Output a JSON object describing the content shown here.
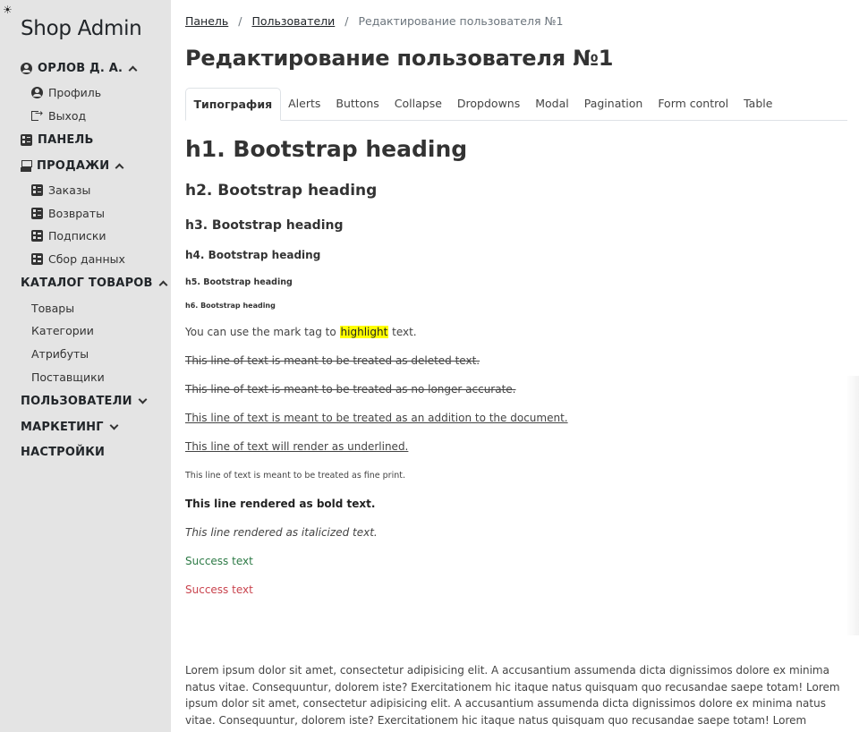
{
  "sidebar": {
    "brand": "Shop Admin",
    "user": {
      "label": "ОРЛОВ Д. А.",
      "items": [
        "Профиль",
        "Выход"
      ]
    },
    "panel": "ПАНЕЛЬ",
    "sales": {
      "label": "ПРОДАЖИ",
      "items": [
        "Заказы",
        "Возвраты",
        "Подписки",
        "Сбор данных"
      ]
    },
    "catalog": {
      "label": "КАТАЛОГ ТОВАРОВ",
      "items": [
        "Товары",
        "Категории",
        "Атрибуты",
        "Поставщики"
      ]
    },
    "users": "ПОЛЬЗОВАТЕЛИ",
    "marketing": "МАРКЕТИНГ",
    "settings": "НАСТРОЙКИ"
  },
  "breadcrumb": [
    "Панель",
    "Пользователи",
    "Редактирование пользователя №1"
  ],
  "breadcrumb_sep": "/",
  "page_title": "Редактирование пользователя №1",
  "tabs": [
    "Типография",
    "Alerts",
    "Buttons",
    "Collapse",
    "Dropdowns",
    "Modal",
    "Pagination",
    "Form control",
    "Table"
  ],
  "typography": {
    "h1": "h1. Bootstrap heading",
    "h2": "h2. Bootstrap heading",
    "h3": "h3. Bootstrap heading",
    "h4": "h4. Bootstrap heading",
    "h5": "h5. Bootstrap heading",
    "h6": "h6. Bootstrap heading",
    "mark_before": "You can use the mark tag to ",
    "mark_word": "highlight",
    "mark_after": " text.",
    "deleted": "This line of text is meant to be treated as deleted text.",
    "strike": "This line of text is meant to be treated as no longer accurate.",
    "inserted": "This line of text is meant to be treated as an addition to the document.",
    "underlined": "This line of text will render as underlined.",
    "fine_print": "This line of text is meant to be treated as fine print.",
    "bold": "This line rendered as bold text.",
    "italic": "This line rendered as italicized text.",
    "success": "Success text",
    "danger": "Success text",
    "lorem": "Lorem ipsum dolor sit amet, consectetur adipisicing elit. A accusantium assumenda dicta dignissimos dolore ex minima natus vitae. Consequuntur, dolorem iste? Exercitationem hic itaque natus quisquam quo recusandae saepe totam! Lorem ipsum dolor sit amet, consectetur adipisicing elit. A accusantium assumenda dicta dignissimos dolore ex minima natus vitae. Consequuntur, dolorem iste? Exercitationem hic itaque natus quisquam quo recusandae saepe totam! Lorem ipsum dolor sit amet, consectetur"
  },
  "colors": {
    "sidebar_bg": "#e4e4e4",
    "mark": "#ffff00",
    "success": "#2d7a46",
    "danger": "#c9444e"
  },
  "icons": {
    "theme": "sun-icon",
    "user": "user-circle-icon",
    "exit": "exit-icon",
    "panel": "panel-icon",
    "sales": "cash-register-icon"
  }
}
